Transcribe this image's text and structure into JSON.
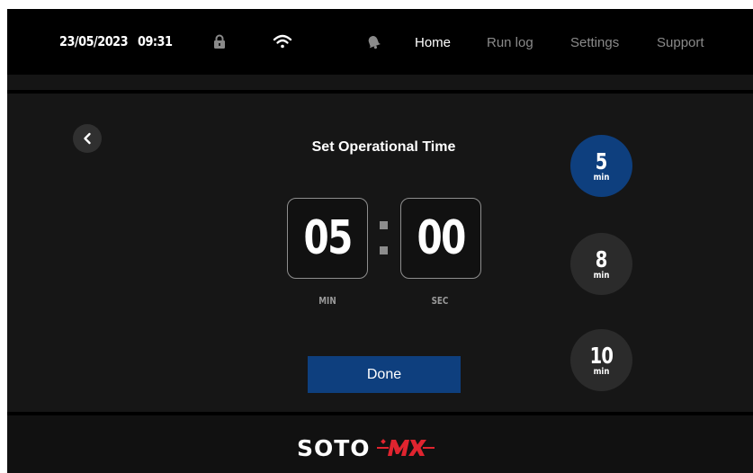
{
  "status_bar": {
    "date": "23/05/2023",
    "time": "09:31",
    "icons": [
      "lock-icon",
      "wifi-icon",
      "bell-icon"
    ]
  },
  "nav": {
    "items": [
      {
        "label": "Home",
        "active": true
      },
      {
        "label": "Run log",
        "active": false
      },
      {
        "label": "Settings",
        "active": false
      },
      {
        "label": "Support",
        "active": false
      }
    ]
  },
  "timer": {
    "title": "Set Operational Time",
    "minutes": "05",
    "seconds": "00",
    "min_label": "MIN",
    "sec_label": "SEC",
    "done_label": "Done"
  },
  "presets": [
    {
      "value": "5",
      "unit": "min",
      "selected": true
    },
    {
      "value": "8",
      "unit": "min",
      "selected": false
    },
    {
      "value": "10",
      "unit": "min",
      "selected": false
    }
  ],
  "footer": {
    "brand": "SOTO",
    "logo_mark": "MX"
  },
  "colors": {
    "accent": "#0e3f7e",
    "background": "#000000",
    "panel": "#161616",
    "inactive_text": "#8a8a8a",
    "brand_red": "#e0242f"
  }
}
